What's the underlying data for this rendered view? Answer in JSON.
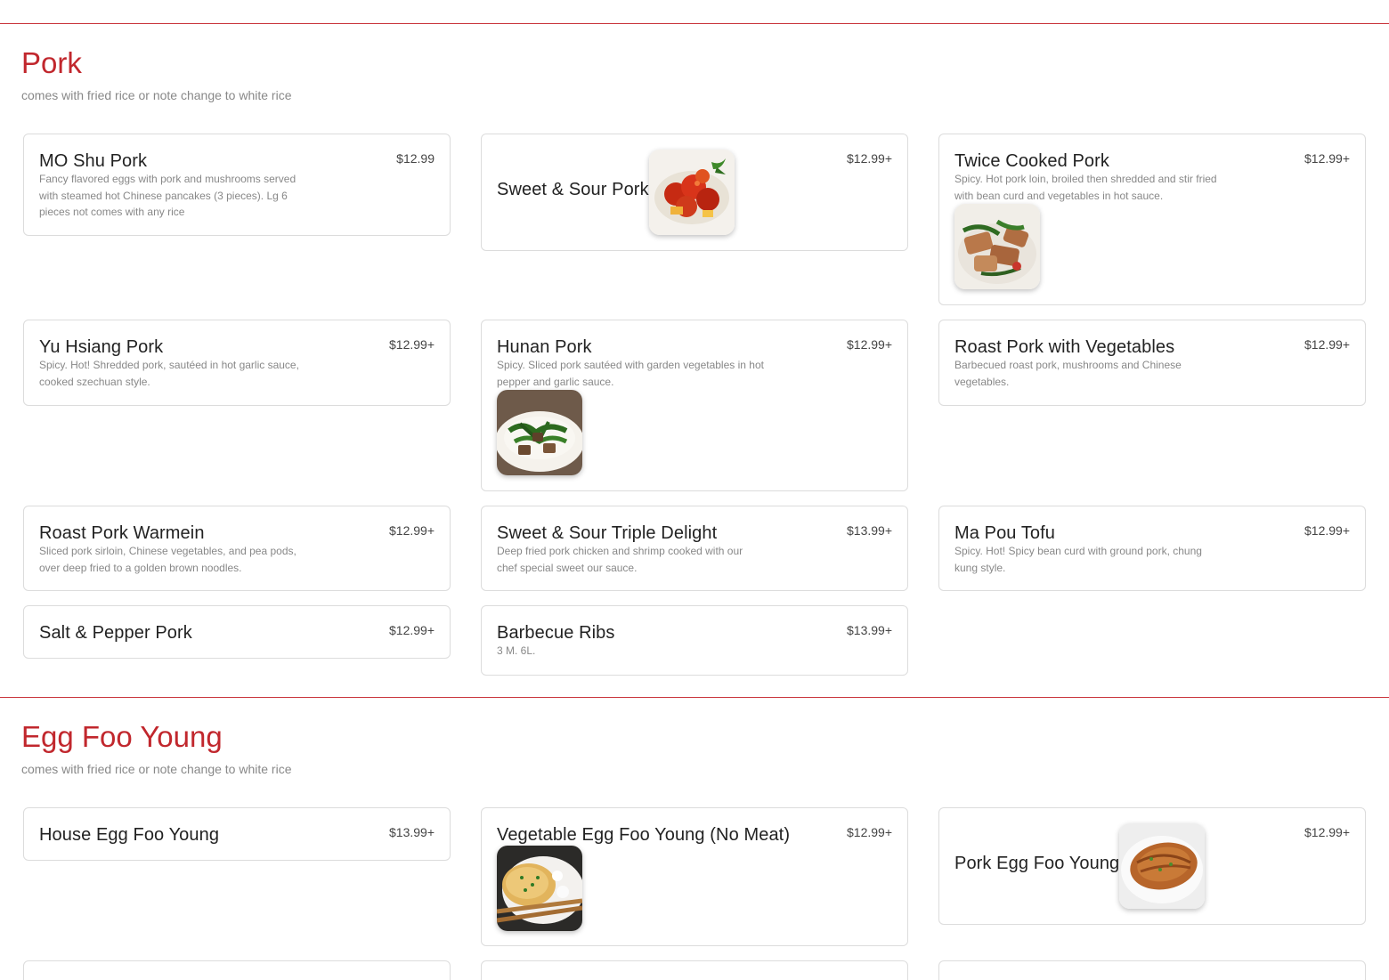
{
  "sections": {
    "pork": {
      "title": "Pork",
      "subtitle": "comes with fried rice or note change to white rice",
      "items": [
        {
          "name": "MO Shu Pork",
          "price": "$12.99",
          "description": "Fancy flavored eggs with pork and mushrooms served with steamed hot Chinese pancakes (3 pieces). Lg 6 pieces not comes with any rice"
        },
        {
          "name": "Sweet & Sour Pork",
          "price": "$12.99+",
          "image": "sweet-sour-pork-photo"
        },
        {
          "name": "Twice Cooked Pork",
          "price": "$12.99+",
          "description": "Spicy. Hot pork loin, broiled then shredded and stir fried with bean curd and vegetables in hot sauce.",
          "image": "twice-cooked-pork-photo"
        },
        {
          "name": "Yu Hsiang Pork",
          "price": "$12.99+",
          "description": "Spicy. Hot! Shredded pork, sautéed in hot garlic sauce, cooked szechuan style."
        },
        {
          "name": "Hunan Pork",
          "price": "$12.99+",
          "description": "Spicy. Sliced pork sautéed with garden vegetables in hot pepper and garlic sauce.",
          "image": "hunan-pork-photo"
        },
        {
          "name": "Roast Pork with Vegetables",
          "price": "$12.99+",
          "description": "Barbecued roast pork, mushrooms and Chinese vegetables."
        },
        {
          "name": "Roast Pork Warmein",
          "price": "$12.99+",
          "description": "Sliced pork sirloin, Chinese vegetables, and pea pods, over deep fried to a golden brown noodles."
        },
        {
          "name": "Sweet & Sour Triple Delight",
          "price": "$13.99+",
          "description": "Deep fried pork chicken and shrimp cooked with our chef special sweet our sauce."
        },
        {
          "name": "Ma Pou Tofu",
          "price": "$12.99+",
          "description": "Spicy. Hot! Spicy bean curd with ground pork, chung kung style."
        },
        {
          "name": "Salt & Pepper Pork",
          "price": "$12.99+"
        },
        {
          "name": "Barbecue Ribs",
          "price": "$13.99+",
          "description": "3 M. 6L."
        }
      ]
    },
    "egg_foo_young": {
      "title": "Egg Foo Young",
      "subtitle": "comes with fried rice or note change to white rice",
      "items": [
        {
          "name": "House Egg Foo Young",
          "price": "$13.99+"
        },
        {
          "name": "Vegetable Egg Foo Young (No Meat)",
          "price": "$12.99+",
          "image": "vegetable-egg-foo-young-photo"
        },
        {
          "name": "Pork Egg Foo Young",
          "price": "$12.99+",
          "image": "pork-egg-foo-young-photo"
        }
      ]
    }
  },
  "colors": {
    "accent": "#c1272d",
    "divider": "#c9343c",
    "card_border": "#dcdcdc",
    "muted_text": "#888888"
  }
}
